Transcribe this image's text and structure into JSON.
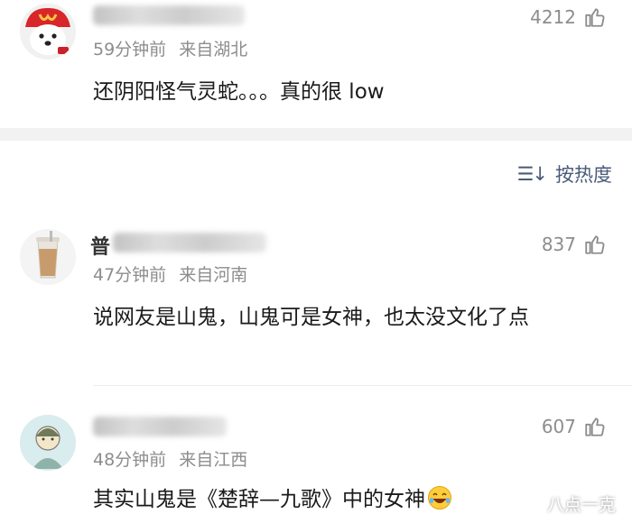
{
  "comments_top": {
    "time": "59分钟前",
    "location": "来自湖北",
    "likes": "4212",
    "text": "还阴阳怪气灵蛇。。。真的很 low"
  },
  "sort": {
    "icon": "sort-icon",
    "label": "按热度"
  },
  "comments": [
    {
      "name_visible": "普",
      "time": "47分钟前",
      "location": "来自河南",
      "likes": "837",
      "text": "说网友是山鬼，山鬼可是女神，也太没文化了点"
    },
    {
      "time": "48分钟前",
      "location": "来自江西",
      "likes": "607",
      "text": "其实山鬼是《楚辞—九歌》中的女神"
    }
  ],
  "watermark": "八点一克",
  "colors": {
    "meta_gray": "#8d8d8d",
    "sort_blue": "#4a5a78",
    "band_gray": "#f2f2f2"
  }
}
